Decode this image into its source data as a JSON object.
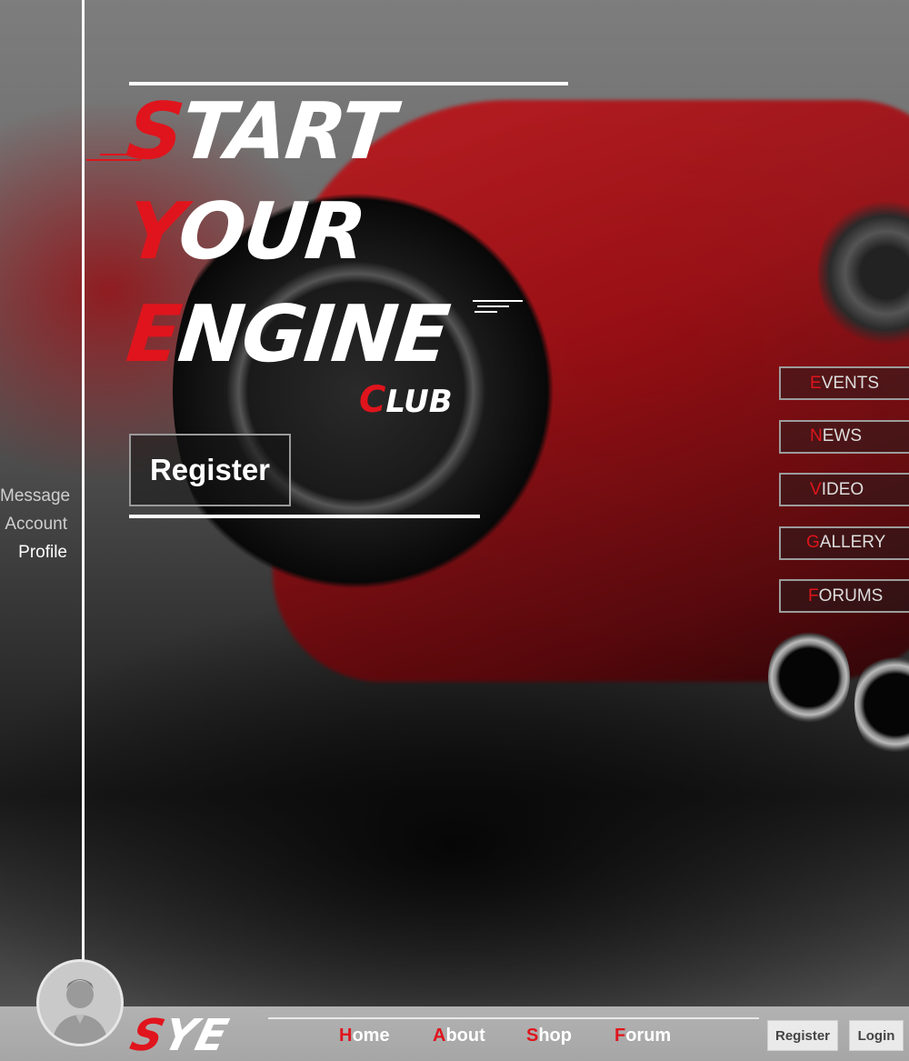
{
  "hero": {
    "line1": {
      "first": "S",
      "rest": "TART"
    },
    "line2": {
      "first": "Y",
      "rest": "OUR"
    },
    "line3": {
      "first": "E",
      "rest": "NGINE"
    },
    "club": {
      "first": "C",
      "rest": "LUB"
    },
    "register_label": "Register"
  },
  "side_menu": {
    "items": [
      "Message",
      "Account",
      "Profile"
    ],
    "active": "Profile"
  },
  "right_nav": [
    {
      "first": "E",
      "rest": "VENTS"
    },
    {
      "first": "N",
      "rest": "EWS"
    },
    {
      "first": "V",
      "rest": "IDEO"
    },
    {
      "first": "G",
      "rest": "ALLERY"
    },
    {
      "first": "F",
      "rest": "ORUMS"
    }
  ],
  "bottom": {
    "logo": {
      "first": "S",
      "rest": "YE"
    },
    "nav": [
      {
        "first": "H",
        "rest": "ome"
      },
      {
        "first": "A",
        "rest": "bout"
      },
      {
        "first": "S",
        "rest": "hop"
      },
      {
        "first": "F",
        "rest": "orum"
      }
    ],
    "register_label": "Register",
    "login_label": "Login"
  },
  "colors": {
    "accent": "#e0141c",
    "text": "#ffffff",
    "bar": "#aaaaaa"
  },
  "icons": {
    "avatar": "user-avatar-icon"
  }
}
